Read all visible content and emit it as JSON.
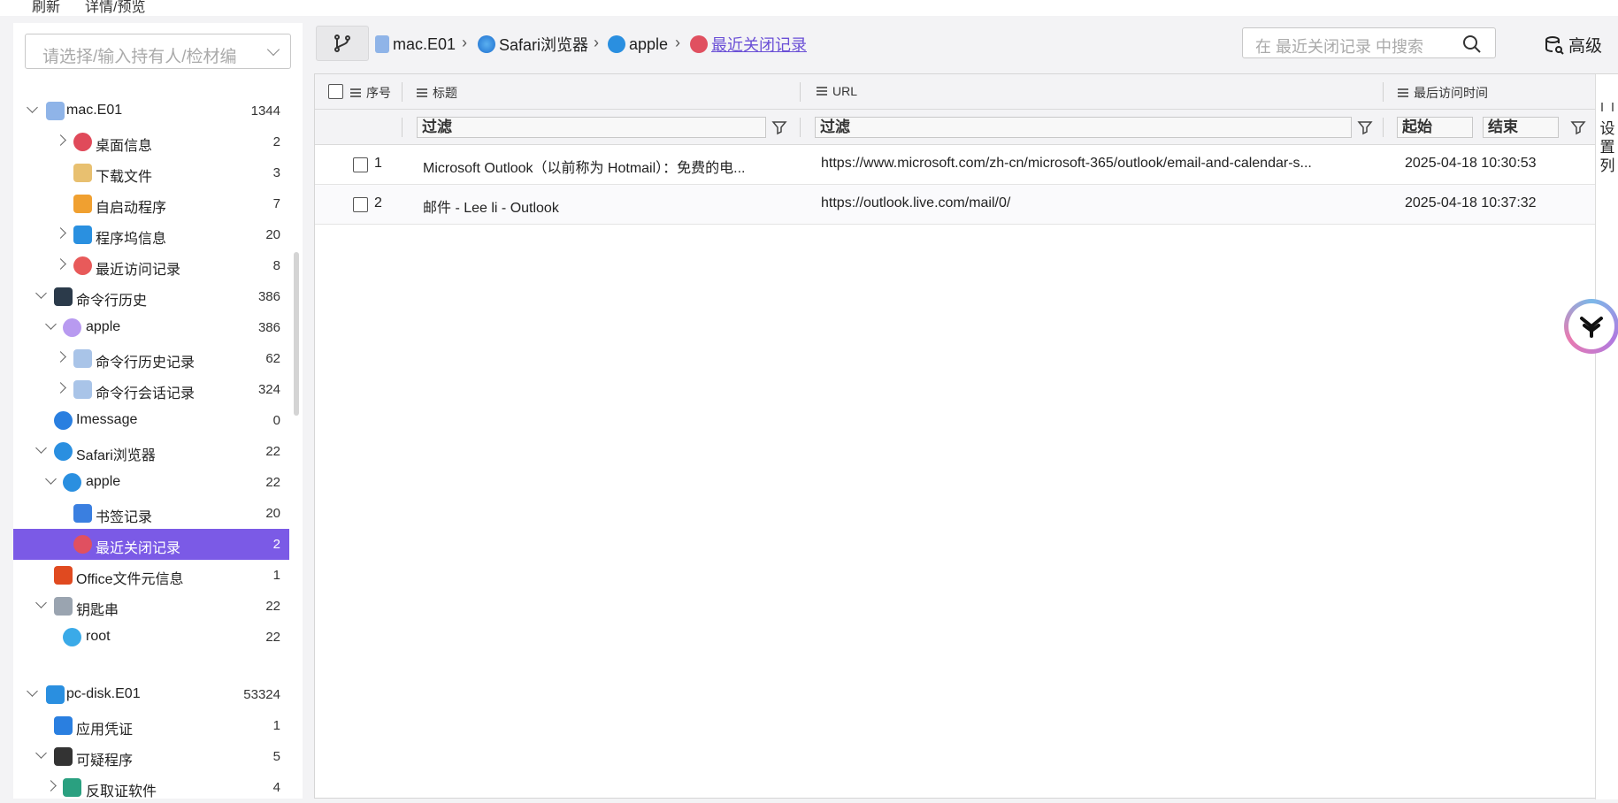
{
  "topmenu": {
    "refresh": "刷新",
    "details": "详情/预览"
  },
  "picker": {
    "placeholder": "请选择/输入持有人/检材编"
  },
  "tree": [
    {
      "label": "mac.E01",
      "count": "1344",
      "icon": "disk-icon",
      "level": 0,
      "toggle": "down"
    },
    {
      "label": "桌面信息",
      "count": "2",
      "icon": "desktop-icon",
      "level": 2,
      "toggle": "right"
    },
    {
      "label": "下载文件",
      "count": "3",
      "icon": "download-folder-icon",
      "level": 2,
      "toggle": ""
    },
    {
      "label": "自启动程序",
      "count": "7",
      "icon": "autostart-icon",
      "level": 2,
      "toggle": ""
    },
    {
      "label": "程序坞信息",
      "count": "20",
      "icon": "dock-icon",
      "level": 2,
      "toggle": "right"
    },
    {
      "label": "最近访问记录",
      "count": "8",
      "icon": "clock-icon",
      "level": 2,
      "toggle": "right"
    },
    {
      "label": "命令行历史",
      "count": "386",
      "icon": "terminal-icon",
      "level": 1,
      "toggle": "down"
    },
    {
      "label": "apple",
      "count": "386",
      "icon": "user-icon",
      "level": 1.5,
      "toggle": "down"
    },
    {
      "label": "命令行历史记录",
      "count": "62",
      "icon": "terminal-file-icon",
      "level": 2,
      "toggle": "right"
    },
    {
      "label": "命令行会话记录",
      "count": "324",
      "icon": "terminal-file-icon",
      "level": 2,
      "toggle": "right"
    },
    {
      "label": "Imessage",
      "count": "0",
      "icon": "imessage-icon",
      "level": 1,
      "toggle": ""
    },
    {
      "label": "Safari浏览器",
      "count": "22",
      "icon": "safari-icon",
      "level": 1,
      "toggle": "down"
    },
    {
      "label": "apple",
      "count": "22",
      "icon": "compass-icon",
      "level": 1.5,
      "toggle": "down"
    },
    {
      "label": "书签记录",
      "count": "20",
      "icon": "bookmark-icon",
      "level": 2,
      "toggle": ""
    },
    {
      "label": "最近关闭记录",
      "count": "2",
      "icon": "closed-tab-icon",
      "level": 2,
      "toggle": "",
      "selected": true
    },
    {
      "label": "Office文件元信息",
      "count": "1",
      "icon": "office-icon",
      "level": 1,
      "toggle": ""
    },
    {
      "label": "钥匙串",
      "count": "22",
      "icon": "keychain-icon",
      "level": 1,
      "toggle": "down"
    },
    {
      "label": "root",
      "count": "22",
      "icon": "key-icon",
      "level": 1.5,
      "toggle": ""
    },
    {
      "label": "pc-disk.E01",
      "count": "53324",
      "icon": "windows-icon",
      "level": 0,
      "toggle": "down",
      "gap": true
    },
    {
      "label": "应用凭证",
      "count": "1",
      "icon": "credential-icon",
      "level": 1,
      "toggle": ""
    },
    {
      "label": "可疑程序",
      "count": "5",
      "icon": "suspicious-icon",
      "level": 1,
      "toggle": "down"
    },
    {
      "label": "反取证软件",
      "count": "4",
      "icon": "list-icon",
      "level": 1.5,
      "toggle": "right"
    }
  ],
  "breadcrumb": [
    {
      "label": "mac.E01"
    },
    {
      "label": "Safari浏览器"
    },
    {
      "label": "apple"
    },
    {
      "label": "最近关闭记录"
    }
  ],
  "search": {
    "placeholder": "在 最近关闭记录 中搜索"
  },
  "advanced_label": "高级",
  "table": {
    "columns": {
      "seq": "序号",
      "title": "标题",
      "url": "URL",
      "time": "最后访问时间"
    },
    "filters": {
      "title": "过滤",
      "url": "过滤",
      "start": "起始",
      "end": "结束"
    },
    "rows": [
      {
        "seq": "1",
        "title": "Microsoft Outlook（以前称为 Hotmail）：免费的电...",
        "url": "https://www.microsoft.com/zh-cn/microsoft-365/outlook/email-and-calendar-s...",
        "time": "2025-04-18 10:30:53"
      },
      {
        "seq": "2",
        "title": "邮件 - Lee li - Outlook",
        "url": "https://outlook.live.com/mail/0/",
        "time": "2025-04-18 10:37:32"
      }
    ]
  },
  "side_strip": {
    "label": "设置列"
  },
  "colors": {
    "accent": "#7b5ae6",
    "link": "#6a4fd6"
  }
}
